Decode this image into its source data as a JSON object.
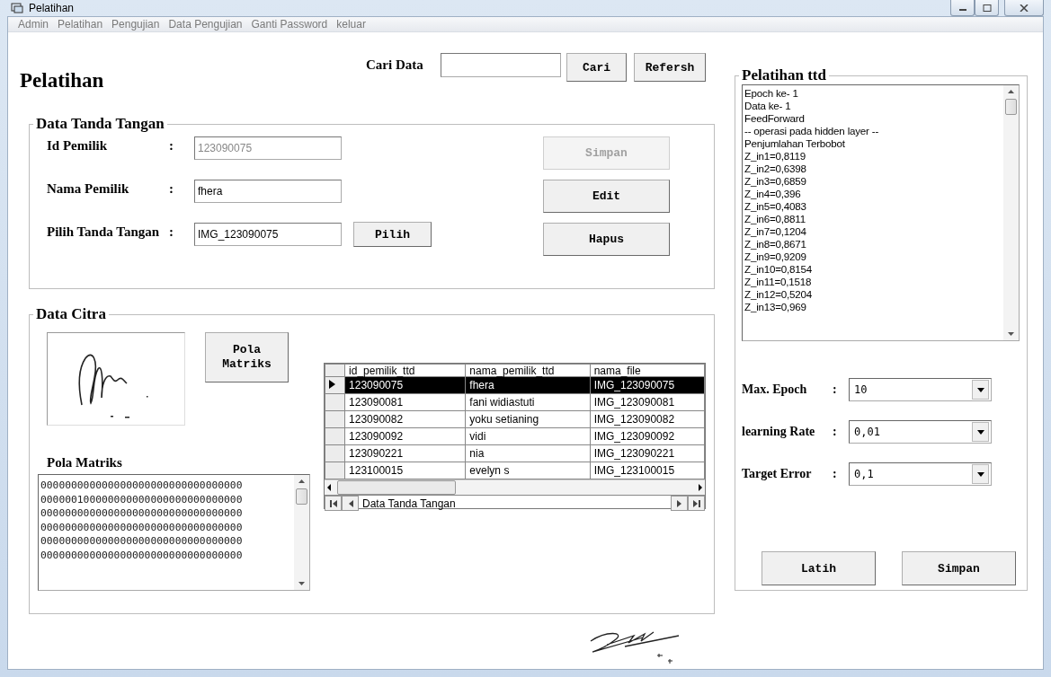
{
  "window": {
    "title": "Pelatihan"
  },
  "menu": [
    "Admin",
    "Pelatihan",
    "Pengujian",
    "Data Pengujian",
    "Ganti Password",
    "keluar"
  ],
  "page_title": "Pelatihan",
  "search": {
    "label": "Cari Data",
    "buttons": [
      "Cari",
      "Refersh"
    ]
  },
  "signature_data": {
    "title": "Data Tanda Tangan",
    "fields": [
      {
        "label": "Id Pemilik",
        "colon": ":",
        "value": "123090075",
        "disabled": true
      },
      {
        "label": "Nama Pemilik",
        "colon": ":",
        "value": "fhera",
        "disabled": false
      },
      {
        "label": "Pilih Tanda Tangan",
        "colon": ":",
        "value": "IMG_123090075",
        "disabled": false
      }
    ],
    "pick_button": "Pilih",
    "buttons": [
      {
        "label": "Simpan",
        "disabled": true
      },
      {
        "label": "Edit",
        "disabled": false
      },
      {
        "label": "Hapus",
        "disabled": false
      }
    ]
  },
  "image_data": {
    "title": "Data Citra",
    "pattern_button": "Pola Matriks",
    "matrix_label": "Pola Matriks",
    "matrix_lines": [
      "000000000000000000000000000000000",
      "000000100000000000000000000000000",
      "000000000000000000000000000000000",
      "000000000000000000000000000000000",
      "000000000000000000000000000000000",
      "000000000000000000000000000000000"
    ],
    "table": {
      "columns": [
        "id_pemilik_ttd",
        "nama_pemilik_ttd",
        "nama_file"
      ],
      "rows": [
        {
          "cells": [
            "123090075",
            "fhera",
            "IMG_123090075"
          ],
          "selected": true
        },
        {
          "cells": [
            "123090081",
            "fani widiastuti",
            "IMG_123090081"
          ],
          "selected": false
        },
        {
          "cells": [
            "123090082",
            "yoku setianing",
            "IMG_123090082"
          ],
          "selected": false
        },
        {
          "cells": [
            "123090092",
            "vidi",
            "IMG_123090092"
          ],
          "selected": false
        },
        {
          "cells": [
            "123090221",
            "nia",
            "IMG_123090221"
          ],
          "selected": false
        },
        {
          "cells": [
            "123100015",
            "evelyn s",
            "IMG_123100015"
          ],
          "selected": false
        }
      ],
      "navigator_caption": "Data Tanda Tangan"
    }
  },
  "training": {
    "title": "Pelatihan ttd",
    "log": [
      "Epoch ke- 1",
      "Data ke- 1",
      "FeedForward",
      "-- operasi pada hidden layer --",
      "Penjumlahan Terbobot",
      "Z_in1=0,8119",
      "Z_in2=0,6398",
      "Z_in3=0,6859",
      "Z_in4=0,396",
      "Z_in5=0,4083",
      "Z_in6=0,8811",
      "Z_in7=0,1204",
      "Z_in8=0,8671",
      "Z_in9=0,9209",
      "Z_in10=0,8154",
      "Z_in11=0,1518",
      "Z_in12=0,5204",
      "Z_in13=0,969"
    ],
    "params": [
      {
        "label": "Max. Epoch",
        "colon": ":",
        "value": "10"
      },
      {
        "label": "learning Rate",
        "colon": ":",
        "value": "0,01"
      },
      {
        "label": "Target Error",
        "colon": ":",
        "value": "0,1"
      }
    ],
    "buttons": [
      "Latih",
      "Simpan"
    ]
  }
}
